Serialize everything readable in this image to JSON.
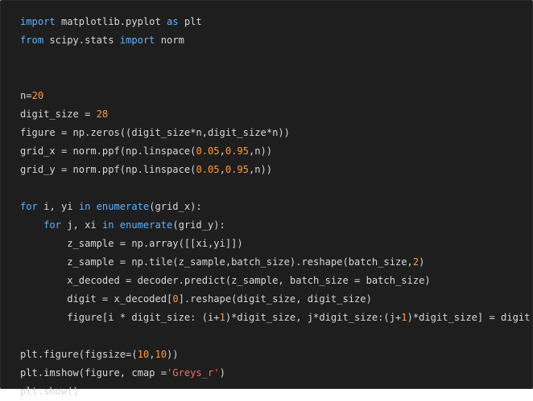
{
  "colors": {
    "background": "#1e1e1e",
    "text": "#d7d7d7",
    "keyword": "#5eb0ff",
    "number": "#ff9a3c",
    "string": "#f26d5b"
  },
  "code": {
    "language": "python",
    "lines": [
      [
        {
          "t": "import",
          "k": "kw"
        },
        {
          "t": " matplotlib.pyplot ",
          "k": "plain"
        },
        {
          "t": "as",
          "k": "kw"
        },
        {
          "t": " plt",
          "k": "plain"
        }
      ],
      [
        {
          "t": "from",
          "k": "kw"
        },
        {
          "t": " scipy.stats ",
          "k": "plain"
        },
        {
          "t": "import",
          "k": "kw"
        },
        {
          "t": " norm",
          "k": "plain"
        }
      ],
      [],
      [],
      [
        {
          "t": "n=",
          "k": "plain"
        },
        {
          "t": "20",
          "k": "num"
        }
      ],
      [
        {
          "t": "digit_size = ",
          "k": "plain"
        },
        {
          "t": "28",
          "k": "num"
        }
      ],
      [
        {
          "t": "figure = np.zeros((digit_size*n,digit_size*n))",
          "k": "plain"
        }
      ],
      [
        {
          "t": "grid_x = norm.ppf(np.linspace(",
          "k": "plain"
        },
        {
          "t": "0.05",
          "k": "num"
        },
        {
          "t": ",",
          "k": "plain"
        },
        {
          "t": "0.95",
          "k": "num"
        },
        {
          "t": ",n))",
          "k": "plain"
        }
      ],
      [
        {
          "t": "grid_y = norm.ppf(np.linspace(",
          "k": "plain"
        },
        {
          "t": "0.05",
          "k": "num"
        },
        {
          "t": ",",
          "k": "plain"
        },
        {
          "t": "0.95",
          "k": "num"
        },
        {
          "t": ",n))",
          "k": "plain"
        }
      ],
      [],
      [
        {
          "t": "for",
          "k": "kw"
        },
        {
          "t": " i, yi ",
          "k": "plain"
        },
        {
          "t": "in",
          "k": "kw"
        },
        {
          "t": " ",
          "k": "plain"
        },
        {
          "t": "enumerate",
          "k": "kw"
        },
        {
          "t": "(grid_x):",
          "k": "plain"
        }
      ],
      [
        {
          "t": "    ",
          "k": "plain"
        },
        {
          "t": "for",
          "k": "kw"
        },
        {
          "t": " j, xi ",
          "k": "plain"
        },
        {
          "t": "in",
          "k": "kw"
        },
        {
          "t": " ",
          "k": "plain"
        },
        {
          "t": "enumerate",
          "k": "kw"
        },
        {
          "t": "(grid_y):",
          "k": "plain"
        }
      ],
      [
        {
          "t": "        z_sample = np.array([[xi,yi]])",
          "k": "plain"
        }
      ],
      [
        {
          "t": "        z_sample = np.tile(z_sample,batch_size).reshape(batch_size,",
          "k": "plain"
        },
        {
          "t": "2",
          "k": "num"
        },
        {
          "t": ")",
          "k": "plain"
        }
      ],
      [
        {
          "t": "        x_decoded = decoder.predict(z_sample, batch_size = batch_size)",
          "k": "plain"
        }
      ],
      [
        {
          "t": "        digit = x_decoded[",
          "k": "plain"
        },
        {
          "t": "0",
          "k": "num"
        },
        {
          "t": "].reshape(digit_size, digit_size)",
          "k": "plain"
        }
      ],
      [
        {
          "t": "        figure[i * digit_size: (i+",
          "k": "plain"
        },
        {
          "t": "1",
          "k": "num"
        },
        {
          "t": ")*digit_size, j*digit_size:(j+",
          "k": "plain"
        },
        {
          "t": "1",
          "k": "num"
        },
        {
          "t": ")*digit_size] = digit",
          "k": "plain"
        }
      ],
      [],
      [
        {
          "t": "plt.figure(figsize=(",
          "k": "plain"
        },
        {
          "t": "10",
          "k": "num"
        },
        {
          "t": ",",
          "k": "plain"
        },
        {
          "t": "10",
          "k": "num"
        },
        {
          "t": "))",
          "k": "plain"
        }
      ],
      [
        {
          "t": "plt.imshow(figure, cmap =",
          "k": "plain"
        },
        {
          "t": "'Greys_r'",
          "k": "str"
        },
        {
          "t": ")",
          "k": "plain"
        }
      ],
      [
        {
          "t": "plt.show()",
          "k": "plain"
        }
      ]
    ]
  }
}
